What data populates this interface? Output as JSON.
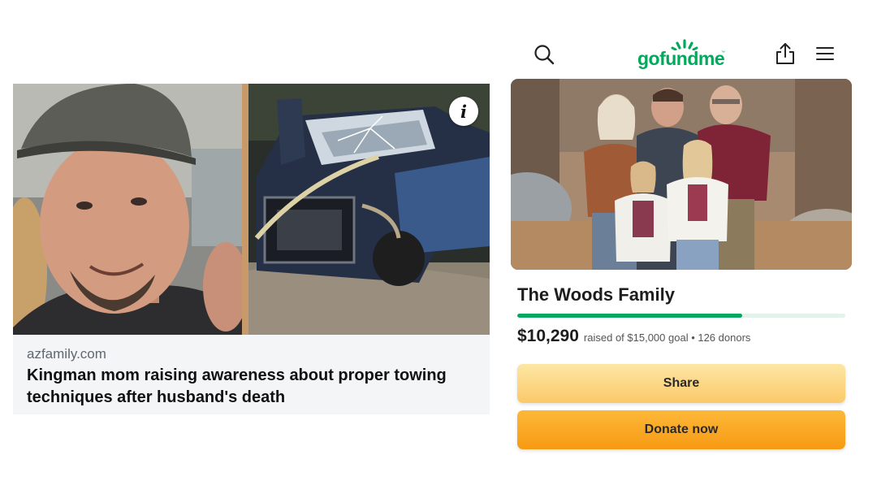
{
  "news_card": {
    "info_glyph": "i",
    "source": "azfamily.com",
    "headline": "Kingman mom raising awareness about proper towing techniques after husband's death"
  },
  "gofundme": {
    "header": {
      "logo_text": "gofundme",
      "logo_tm": "™",
      "brand_color": "#02a95c",
      "icons": [
        "search-icon",
        "share-upload-icon",
        "menu-icon"
      ]
    },
    "campaign": {
      "title": "The Woods Family",
      "raised_amount": "$10,290",
      "raised_detail": "raised of $15,000 goal • 126 donors",
      "progress_fraction": 0.686
    },
    "buttons": {
      "share_label": "Share",
      "donate_label": "Donate now"
    }
  }
}
